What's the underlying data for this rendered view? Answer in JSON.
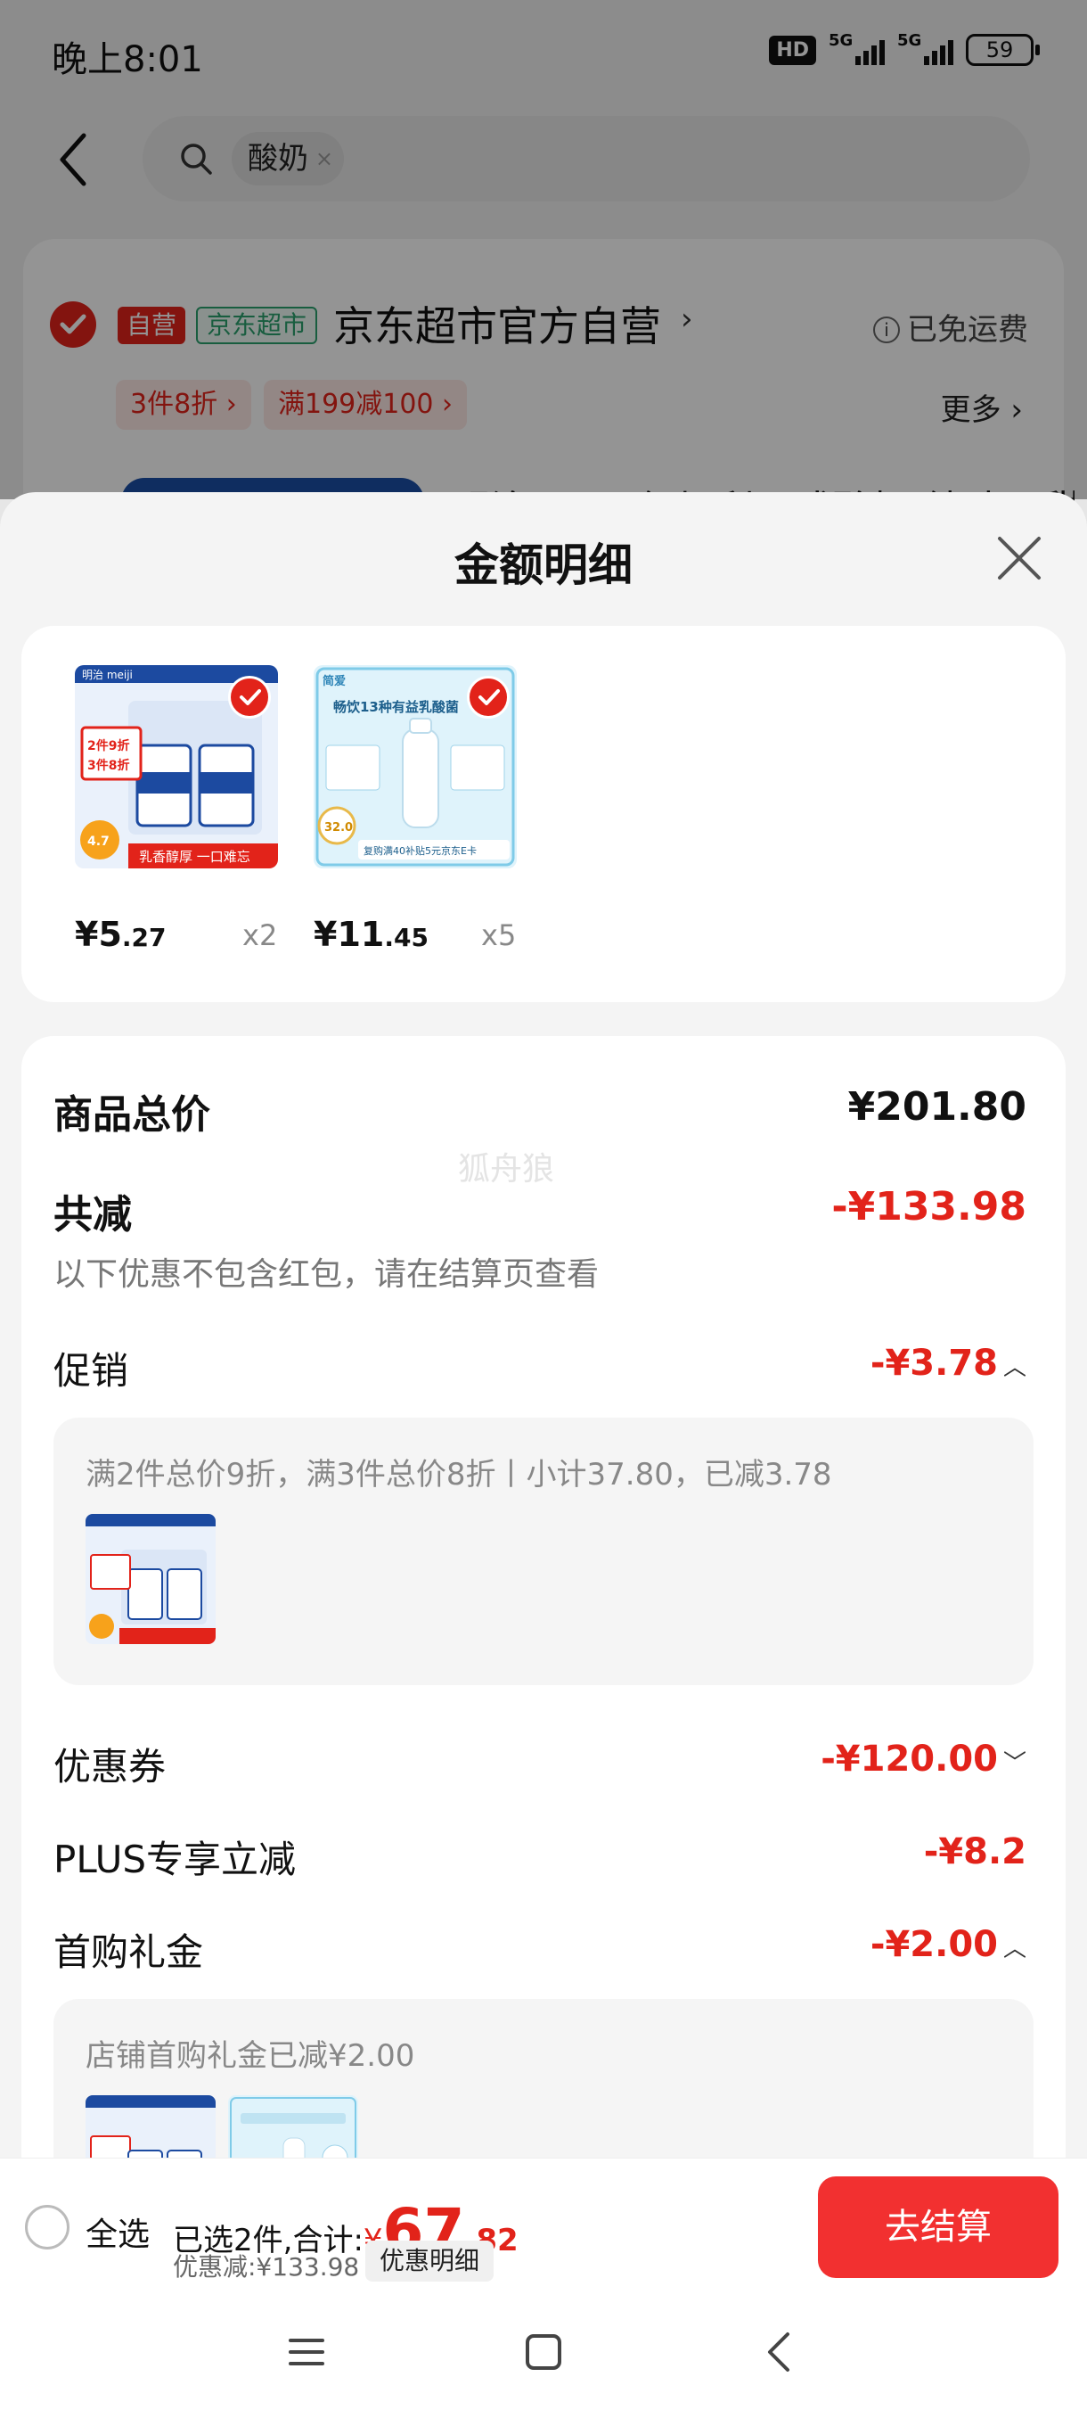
{
  "status_bar": {
    "time": "晚上8:01",
    "hd": "HD",
    "net1": "5G",
    "net2": "5G",
    "battery": "59"
  },
  "search": {
    "query": "酸奶"
  },
  "store": {
    "tag_self": "自营",
    "tag_market": "京东超市",
    "name": "京东超市官方自营",
    "free_shipping": "已免运费",
    "promo_chips": [
      "3件8折 ›",
      "满199减100 ›"
    ],
    "more": "更多 ›",
    "product_title_peek": "明治meiji 保加利亚式酸奶 纯味不甜"
  },
  "sheet": {
    "title": "金额明细",
    "products": [
      {
        "price_int": "¥5",
        "price_dec": ".27",
        "qty": "x2",
        "img_badge": "2件9折 3件8折",
        "img_brand": "明治 meiji",
        "img_score": "4.7",
        "img_caption": "乳香醇厚  一口难忘"
      },
      {
        "price_int": "¥11",
        "price_dec": ".45",
        "qty": "x5",
        "img_brand": "简爱",
        "img_headline": "畅饮13种有益乳酸菌",
        "img_price": "32.0",
        "img_footer": "复购满40补贴5元京东E卡"
      }
    ],
    "watermark": "狐舟狼",
    "total": {
      "label": "商品总价",
      "value": "¥201.80"
    },
    "discount": {
      "label": "共减",
      "value": "-¥133.98",
      "note": "以下优惠不包含红包，请在结算页查看"
    },
    "promotion": {
      "label": "促销",
      "value": "-¥3.78",
      "caret": "︿",
      "detail": "满2件总价9折，满3件总价8折丨小计37.80，已减3.78"
    },
    "coupon": {
      "label": "优惠券",
      "value": "-¥120.00",
      "caret": "﹀"
    },
    "plus": {
      "label": "PLUS专享立减",
      "value": "-¥8.2"
    },
    "first_buy": {
      "label": "首购礼金",
      "value": "-¥2.00",
      "caret": "︿",
      "detail": "店铺首购礼金已减¥2.00"
    }
  },
  "action_bar": {
    "select_all": "全选",
    "selected_prefix": "已选2件,合计:",
    "yen": "¥",
    "total_int": "67",
    "total_dec": ".82",
    "saved": "优惠减:¥133.98",
    "detail_btn": "优惠明细",
    "checkout": "去结算"
  },
  "colors": {
    "accent_red": "#e2231a",
    "checkout_red": "#f23030",
    "market_green": "#2aa06d"
  },
  "icons": [
    "back-arrow-icon",
    "search-icon",
    "close-icon",
    "check-icon",
    "info-icon",
    "menu-icon",
    "home-square-icon",
    "back-triangle-icon"
  ]
}
